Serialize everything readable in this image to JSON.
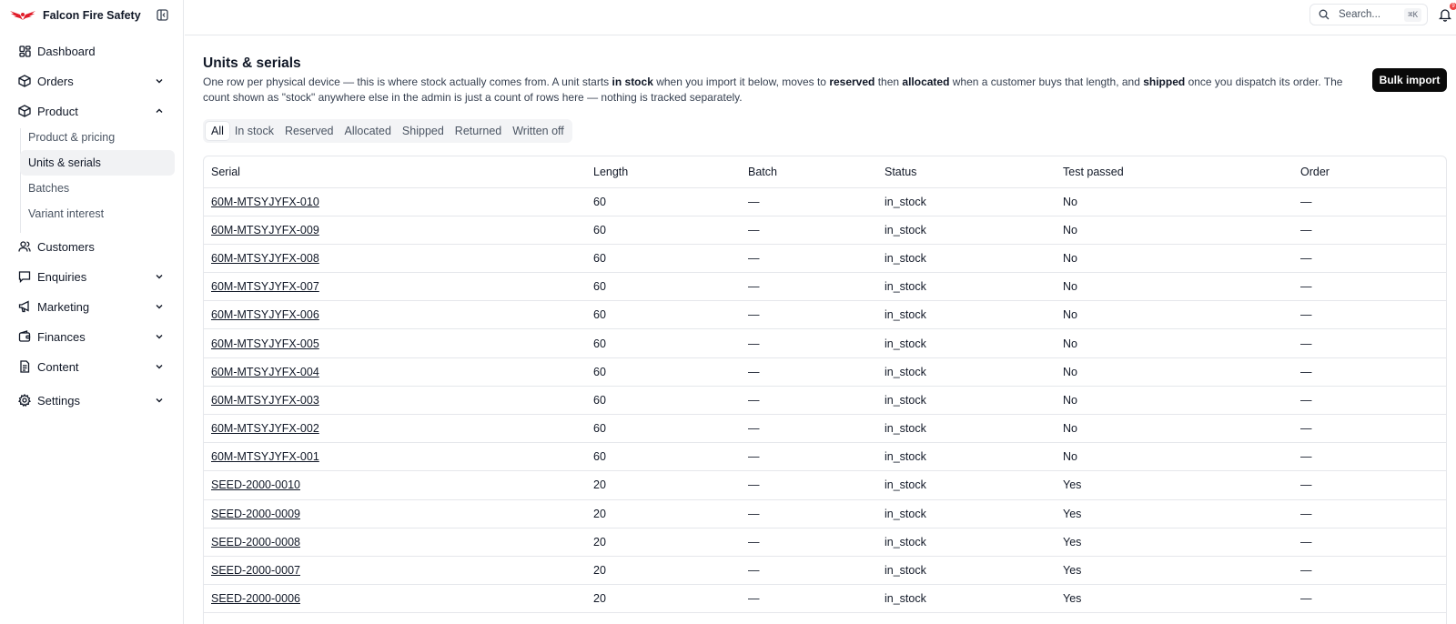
{
  "brand": {
    "name": "Falcon Fire Safety",
    "accent": "#e11d2a"
  },
  "sidebar": {
    "items": [
      {
        "label": "Dashboard",
        "icon": "dashboard-icon"
      },
      {
        "label": "Orders",
        "icon": "box-icon",
        "expandable": true
      },
      {
        "label": "Product",
        "icon": "box-icon",
        "expanded": true
      },
      {
        "label": "Customers",
        "icon": "users-icon"
      },
      {
        "label": "Enquiries",
        "icon": "message-icon",
        "expandable": true
      },
      {
        "label": "Marketing",
        "icon": "megaphone-icon",
        "expandable": true
      },
      {
        "label": "Finances",
        "icon": "wallet-icon",
        "expandable": true
      },
      {
        "label": "Content",
        "icon": "document-icon",
        "expandable": true
      },
      {
        "label": "Settings",
        "icon": "gear-icon",
        "expandable": true
      }
    ],
    "product_subitems": [
      {
        "label": "Product & pricing"
      },
      {
        "label": "Units & serials",
        "active": true
      },
      {
        "label": "Batches"
      },
      {
        "label": "Variant interest"
      }
    ]
  },
  "topbar": {
    "search_placeholder": "Search...",
    "search_shortcut": "⌘K",
    "notification_count": "9"
  },
  "page": {
    "title": "Units & serials",
    "desc_parts": [
      "One row per physical device — this is where stock actually comes from. A unit starts ",
      "in stock",
      " when you import it below, moves to ",
      "reserved",
      " then ",
      "allocated",
      " when a customer buys that length, and ",
      "shipped",
      " once you dispatch its order. The count shown as \"stock\" anywhere else in the admin is just a count of rows here — nothing is tracked separately."
    ],
    "bulk_import_label": "Bulk import"
  },
  "tabs": [
    {
      "label": "All",
      "active": true
    },
    {
      "label": "In stock"
    },
    {
      "label": "Reserved"
    },
    {
      "label": "Allocated"
    },
    {
      "label": "Shipped"
    },
    {
      "label": "Returned"
    },
    {
      "label": "Written off"
    }
  ],
  "table": {
    "columns": [
      "Serial",
      "Length",
      "Batch",
      "Status",
      "Test passed",
      "Order"
    ],
    "rows": [
      [
        "60M-MTSYJYFX-010",
        "60",
        "—",
        "in_stock",
        "No",
        "—"
      ],
      [
        "60M-MTSYJYFX-009",
        "60",
        "—",
        "in_stock",
        "No",
        "—"
      ],
      [
        "60M-MTSYJYFX-008",
        "60",
        "—",
        "in_stock",
        "No",
        "—"
      ],
      [
        "60M-MTSYJYFX-007",
        "60",
        "—",
        "in_stock",
        "No",
        "—"
      ],
      [
        "60M-MTSYJYFX-006",
        "60",
        "—",
        "in_stock",
        "No",
        "—"
      ],
      [
        "60M-MTSYJYFX-005",
        "60",
        "—",
        "in_stock",
        "No",
        "—"
      ],
      [
        "60M-MTSYJYFX-004",
        "60",
        "—",
        "in_stock",
        "No",
        "—"
      ],
      [
        "60M-MTSYJYFX-003",
        "60",
        "—",
        "in_stock",
        "No",
        "—"
      ],
      [
        "60M-MTSYJYFX-002",
        "60",
        "—",
        "in_stock",
        "No",
        "—"
      ],
      [
        "60M-MTSYJYFX-001",
        "60",
        "—",
        "in_stock",
        "No",
        "—"
      ],
      [
        "SEED-2000-0010",
        "20",
        "—",
        "in_stock",
        "Yes",
        "—"
      ],
      [
        "SEED-2000-0009",
        "20",
        "—",
        "in_stock",
        "Yes",
        "—"
      ],
      [
        "SEED-2000-0008",
        "20",
        "—",
        "in_stock",
        "Yes",
        "—"
      ],
      [
        "SEED-2000-0007",
        "20",
        "—",
        "in_stock",
        "Yes",
        "—"
      ],
      [
        "SEED-2000-0006",
        "20",
        "—",
        "in_stock",
        "Yes",
        "—"
      ]
    ]
  }
}
